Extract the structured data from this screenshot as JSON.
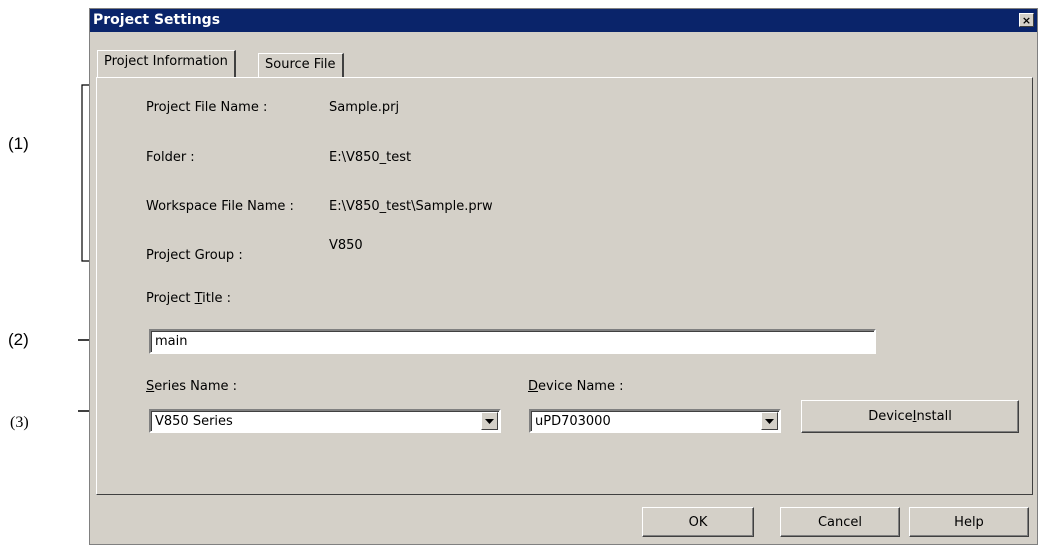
{
  "annotations": {
    "one": "(1)",
    "two": "(2)",
    "three": "(3)"
  },
  "dialog": {
    "title": "Project Settings",
    "close_glyph": "×"
  },
  "tabs": [
    {
      "label": "Project Information",
      "active": true
    },
    {
      "label": "Source File",
      "active": false
    }
  ],
  "info": {
    "project_file_label": "Project File Name :",
    "project_file_value": "Sample.prj",
    "folder_label": "Folder :",
    "folder_value": "E:\\V850_test",
    "workspace_label": "Workspace File Name :",
    "workspace_value": "E:\\V850_test\\Sample.prw",
    "group_label": "Project Group :",
    "group_value": "V850"
  },
  "project_title": {
    "label_pre": "Project ",
    "label_acc": "T",
    "label_post": "itle :",
    "value": "main"
  },
  "series": {
    "label_acc": "S",
    "label_post": "eries Name :",
    "selected": "V850 Series"
  },
  "device": {
    "label_acc": "D",
    "label_post": "evice Name :",
    "selected": "uPD703000",
    "install_pre": "Device ",
    "install_acc": "I",
    "install_post": "nstall"
  },
  "buttons": {
    "ok": "OK",
    "cancel": "Cancel",
    "help": "Help"
  },
  "colors": {
    "face": "#d4d0c8",
    "titlebar": "#0a246a"
  }
}
